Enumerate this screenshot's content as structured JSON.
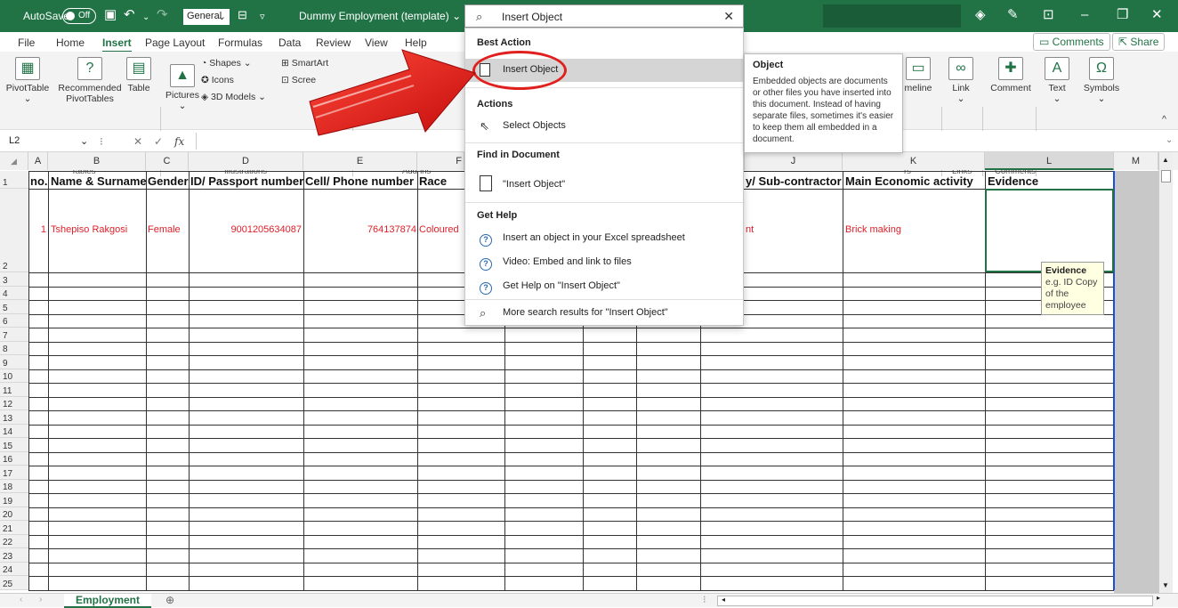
{
  "titlebar": {
    "autosave": "AutoSave",
    "toggle": "Off",
    "number_format": "General",
    "doc_title": "Dummy Employment (template)",
    "doc_chevron": "⌄"
  },
  "ribbon_tabs": [
    "File",
    "Home",
    "Insert",
    "Page Layout",
    "Formulas",
    "Data",
    "Review",
    "View",
    "Help"
  ],
  "active_tab": "Insert",
  "comments_btn": "Comments",
  "share_btn": "Share",
  "ribbon": {
    "pivottable": "PivotTable",
    "recommended": "Recommended",
    "pivottables": "PivotTables",
    "table": "Table",
    "pictures": "Pictures",
    "shapes": "Shapes",
    "icons": "Icons",
    "models": "3D Models",
    "smartart": "SmartArt",
    "screenshot": "Scree",
    "timeline": "meline",
    "link": "Link",
    "comment": "Comment",
    "text": "Text",
    "symbols": "Symbols",
    "grp_tables": "Tables",
    "grp_illustrations": "Illustrations",
    "grp_addins": "Add-ins",
    "grp_filters": "rs",
    "grp_links": "Links",
    "grp_comments": "Comments"
  },
  "namebox": "L2",
  "fx": "fx",
  "columns": [
    "A",
    "B",
    "C",
    "D",
    "E",
    "F",
    "J",
    "K",
    "L",
    "M"
  ],
  "header_row": {
    "no": "no.",
    "name": "Name & Surname",
    "gender": "Gender",
    "id": "ID/ Passport number",
    "cell": "Cell/ Phone number",
    "race": "Race",
    "sub": "y/ Sub-contractor",
    "activity": "Main Economic activity",
    "evidence": "Evidence"
  },
  "data_row": {
    "no": "1",
    "name": "Tshepiso Rakgosi",
    "gender": "Female",
    "id": "9001205634087",
    "cell": "764137874",
    "race": "Coloured",
    "sub": "nt",
    "activity": "Brick making"
  },
  "row_numbers": [
    "1",
    "2",
    "3",
    "4",
    "5",
    "6",
    "7",
    "8",
    "9",
    "10",
    "11",
    "12",
    "13",
    "14",
    "15",
    "16",
    "17",
    "18",
    "19",
    "20",
    "21",
    "22",
    "23",
    "24",
    "25"
  ],
  "search": {
    "value": "Insert Object"
  },
  "dropdown": {
    "best_action": "Best Action",
    "best_item": "Insert Object",
    "actions": "Actions",
    "select_objects": "Select Objects",
    "find": "Find in Document",
    "find_item": "\"Insert Object\"",
    "get_help": "Get Help",
    "help1": "Insert an object in your Excel spreadsheet",
    "help2": "Video: Embed and link to files",
    "help3": "Get Help on \"Insert Object\"",
    "more": "More search results for \"Insert Object\""
  },
  "tooltip": {
    "title": "Object",
    "body": "Embedded objects are documents or other files you have inserted into this document. Instead of having separate files, sometimes it's easier to keep them all embedded in a document."
  },
  "comment": {
    "title": "Evidence",
    "body": "e.g. ID Copy of the employee"
  },
  "sheet_tab": "Employment",
  "colors": {
    "excel_green": "#217346",
    "highlight_red": "#e0201d",
    "data_red": "#e0202a"
  }
}
